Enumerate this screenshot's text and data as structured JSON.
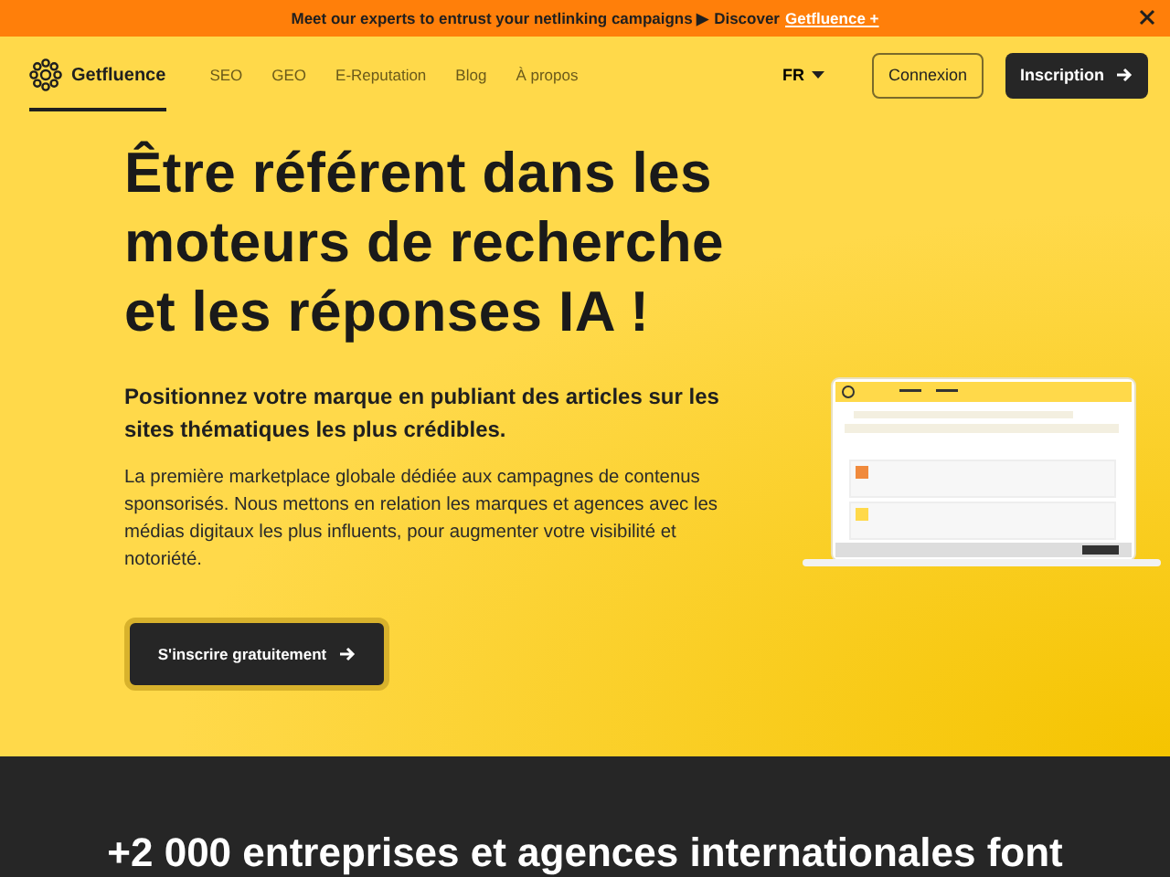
{
  "banner": {
    "text": "Meet our experts to entrust your netlinking campaigns ▶ Discover",
    "link": "Getfluence +"
  },
  "nav": {
    "logo": "Getfluence",
    "links": [
      {
        "label": "SEO"
      },
      {
        "label": "GEO"
      },
      {
        "label": "E-Reputation"
      },
      {
        "label": "Blog"
      },
      {
        "label": "À propos"
      }
    ],
    "language": "FR",
    "login": "Connexion",
    "signup": "Inscription"
  },
  "hero": {
    "title": "Être référent dans les moteurs de recherche et les réponses IA !",
    "subtitle": "Positionnez votre marque en publiant des articles sur les sites thématiques les plus crédibles.",
    "body": "La première marketplace globale dédiée aux campagnes de contenus sponsorisés. Nous mettons en relation les marques et agences avec les médias digitaux les plus influents, pour augmenter votre visibilité et notoriété.",
    "cta": "S'inscrire gratuitement"
  },
  "trust": {
    "heading": "+2 000 entreprises et agences internationales font"
  }
}
